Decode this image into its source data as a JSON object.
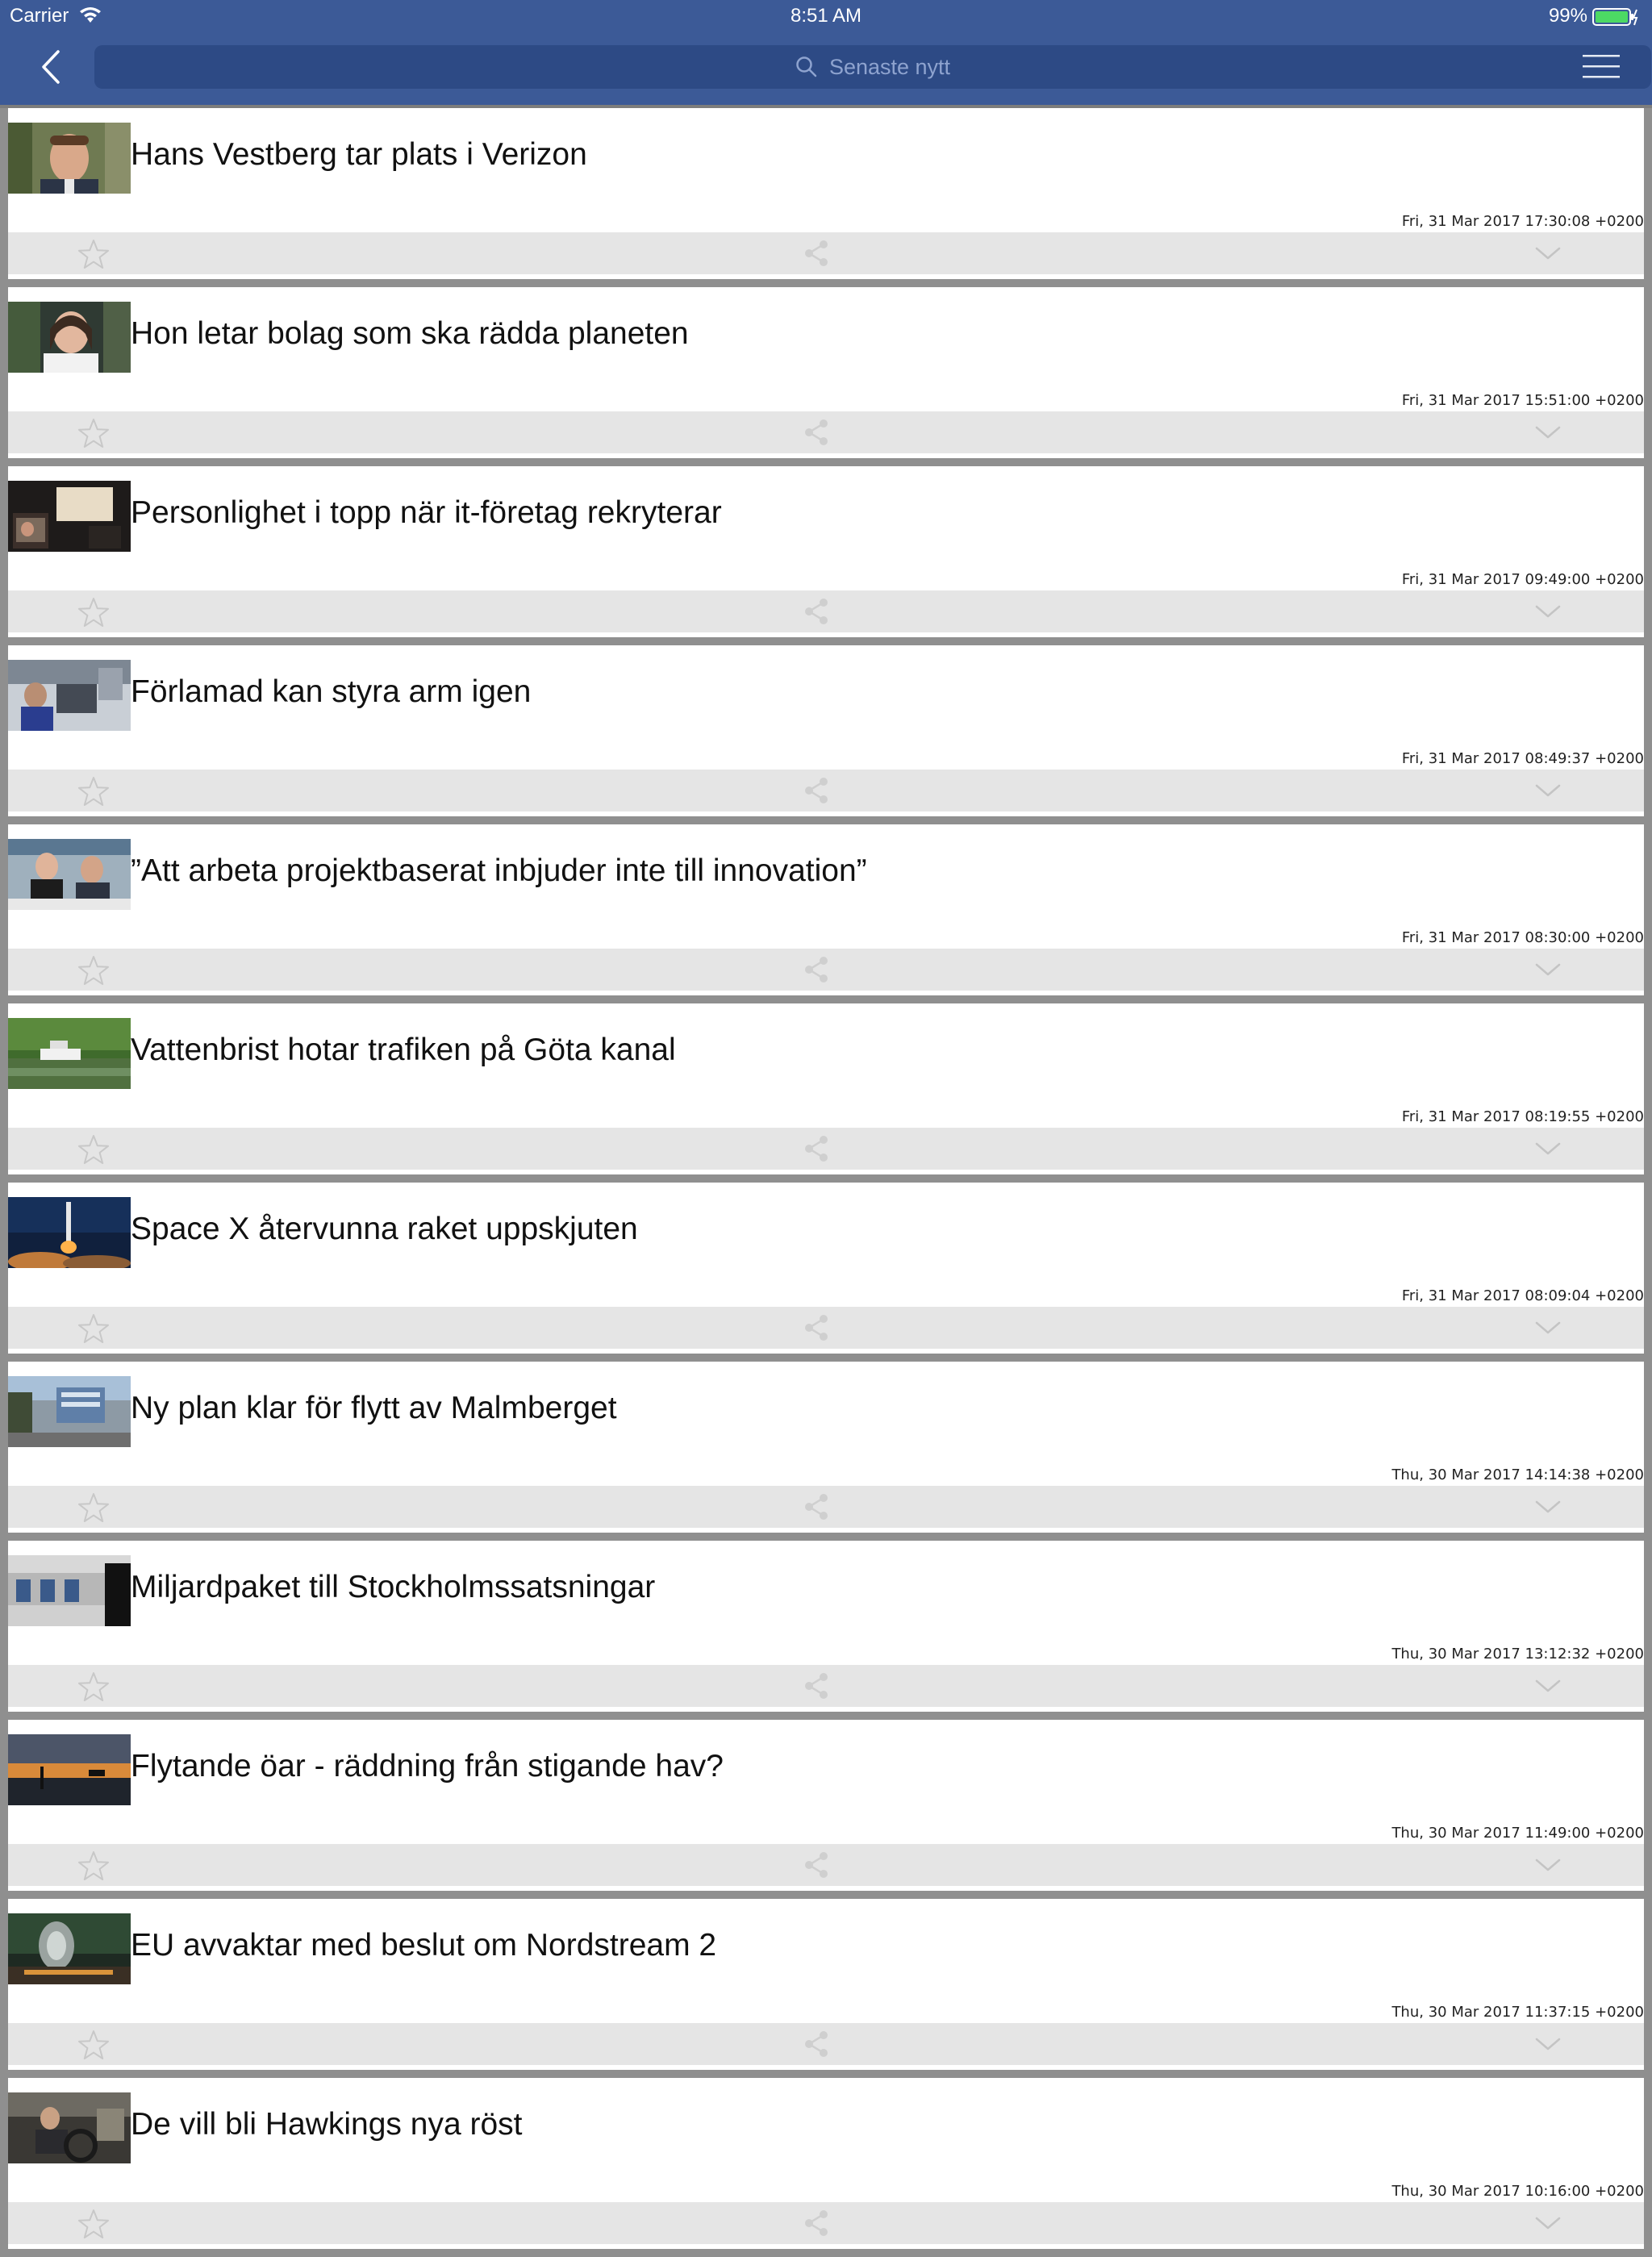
{
  "status_bar": {
    "carrier": "Carrier",
    "time": "8:51 AM",
    "battery": "99%",
    "icons": [
      "wifi-icon",
      "battery-icon"
    ]
  },
  "header": {
    "back_icon": "chevron-left-icon",
    "search_placeholder": "Senaste nytt",
    "menu_icon": "hamburger-menu-icon",
    "bar_color": "#3c5a97",
    "search_color": "#2d4a85"
  },
  "articles": [
    {
      "title": "Hans Vestberg tar plats i Verizon",
      "date": "Fri, 31 Mar 2017 17:30:08 +0200",
      "thumb": "portrait-man"
    },
    {
      "title": "Hon letar bolag som ska rädda planeten",
      "date": "Fri, 31 Mar 2017 15:51:00 +0200",
      "thumb": "portrait-woman"
    },
    {
      "title": "Personlighet i topp när it-företag rekryterar",
      "date": "Fri, 31 Mar 2017 09:49:00 +0200",
      "thumb": "office-screens"
    },
    {
      "title": "Förlamad kan styra arm igen",
      "date": "Fri, 31 Mar 2017 08:49:37 +0200",
      "thumb": "lab"
    },
    {
      "title": "”Att arbeta projektbaserat inbjuder inte till innovation”",
      "date": "Fri, 31 Mar 2017 08:30:00 +0200",
      "thumb": "two-men"
    },
    {
      "title": "Vattenbrist hotar trafiken på Göta kanal",
      "date": "Fri, 31 Mar 2017 08:19:55 +0200",
      "thumb": "canal-boat"
    },
    {
      "title": "Space X återvunna raket uppskjuten",
      "date": "Fri, 31 Mar 2017 08:09:04 +0200",
      "thumb": "rocket-launch"
    },
    {
      "title": "Ny plan klar för flytt av Malmberget",
      "date": "Thu, 30 Mar 2017 14:14:38 +0200",
      "thumb": "town"
    },
    {
      "title": "Miljardpaket till Stockholmssatsningar",
      "date": "Thu, 30 Mar 2017 13:12:32 +0200",
      "thumb": "subway"
    },
    {
      "title": "Flytande öar - räddning från stigande hav?",
      "date": "Thu, 30 Mar 2017 11:49:00 +0200",
      "thumb": "sunset-sea"
    },
    {
      "title": "EU avvaktar med beslut om Nordstream 2",
      "date": "Thu, 30 Mar 2017 11:37:15 +0200",
      "thumb": "pipeline"
    },
    {
      "title": "De vill bli Hawkings nya röst",
      "date": "Thu, 30 Mar 2017 10:16:00 +0200",
      "thumb": "wheelchair"
    }
  ],
  "article_action_icons": [
    "star-icon",
    "share-icon",
    "chevron-down-icon"
  ]
}
